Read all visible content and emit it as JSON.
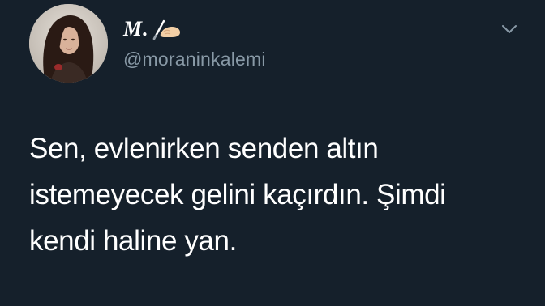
{
  "tweet": {
    "display_name": "M.",
    "display_name_icon": "writing-hand-icon",
    "handle": "@moraninkalemi",
    "menu_icon": "chevron-down-icon",
    "text_lines": [
      "Sen, evlenirken senden altın",
      "istemeyecek gelini kaçırdın. Şimdi",
      "kendi haline yan."
    ]
  },
  "colors": {
    "background": "#15202b",
    "primary_text": "#ffffff",
    "secondary_text": "#8899a6"
  }
}
